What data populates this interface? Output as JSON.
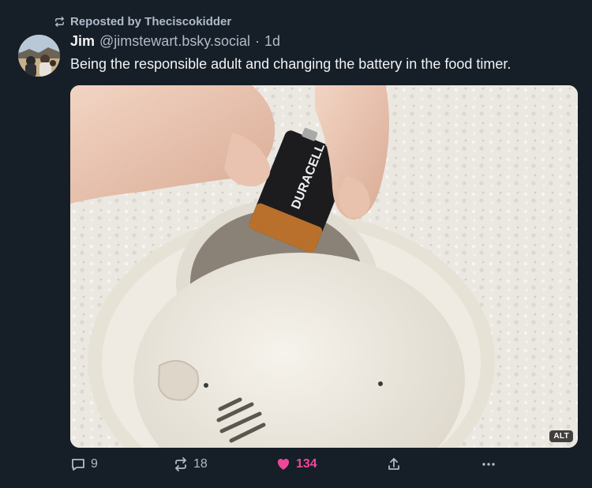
{
  "repost": {
    "label": "Reposted by Theciscokidder"
  },
  "post": {
    "author_name": "Jim",
    "author_handle": "@jimstewart.bsky.social",
    "separator": "·",
    "time": "1d",
    "text": "Being the responsible adult and changing the battery in the food timer.",
    "image": {
      "alt_badge": "ALT",
      "battery_brand": "DURACELL"
    }
  },
  "actions": {
    "replies": "9",
    "reposts": "18",
    "likes": "134",
    "share_icon": "share-icon",
    "more_icon": "more-icon"
  },
  "colors": {
    "background": "#161e27",
    "text": "#f1f3f5",
    "muted": "#aebbc9",
    "like": "#ec4899"
  }
}
